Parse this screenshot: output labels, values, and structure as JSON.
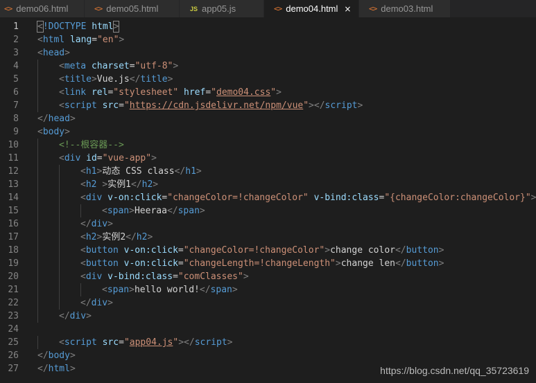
{
  "tabs": [
    {
      "label": "demo06.html",
      "icon": "html-file-icon",
      "icon_glyph": "<>",
      "active": false
    },
    {
      "label": "demo05.html",
      "icon": "html-file-icon",
      "icon_glyph": "<>",
      "active": false
    },
    {
      "label": "app05.js",
      "icon": "js-file-icon",
      "icon_glyph": "JS",
      "active": false
    },
    {
      "label": "demo04.html",
      "icon": "html-file-icon",
      "icon_glyph": "<>",
      "active": true,
      "close_glyph": "×"
    },
    {
      "label": "demo03.html",
      "icon": "html-file-icon",
      "icon_glyph": "<>",
      "active": false
    }
  ],
  "editor": {
    "current_line": 1,
    "lines": [
      {
        "n": "1",
        "indent": 0,
        "tokens": [
          [
            "punct",
            "<"
          ],
          [
            "kw",
            "!DOCTYPE"
          ],
          [
            "text",
            " "
          ],
          [
            "attr",
            "html"
          ],
          [
            "punct",
            ">"
          ]
        ]
      },
      {
        "n": "2",
        "indent": 0,
        "tokens": [
          [
            "punct",
            "<"
          ],
          [
            "tag",
            "html"
          ],
          [
            "text",
            " "
          ],
          [
            "attr",
            "lang"
          ],
          [
            "text",
            "="
          ],
          [
            "str",
            "\"en\""
          ],
          [
            "punct",
            ">"
          ]
        ]
      },
      {
        "n": "3",
        "indent": 0,
        "tokens": [
          [
            "punct",
            "<"
          ],
          [
            "tag",
            "head"
          ],
          [
            "punct",
            ">"
          ]
        ]
      },
      {
        "n": "4",
        "indent": 1,
        "tokens": [
          [
            "punct",
            "<"
          ],
          [
            "tag",
            "meta"
          ],
          [
            "text",
            " "
          ],
          [
            "attr",
            "charset"
          ],
          [
            "text",
            "="
          ],
          [
            "str",
            "\"utf-8\""
          ],
          [
            "punct",
            ">"
          ]
        ]
      },
      {
        "n": "5",
        "indent": 1,
        "tokens": [
          [
            "punct",
            "<"
          ],
          [
            "tag",
            "title"
          ],
          [
            "punct",
            ">"
          ],
          [
            "text",
            "Vue.js"
          ],
          [
            "punct",
            "</"
          ],
          [
            "tag",
            "title"
          ],
          [
            "punct",
            ">"
          ]
        ]
      },
      {
        "n": "6",
        "indent": 1,
        "tokens": [
          [
            "punct",
            "<"
          ],
          [
            "tag",
            "link"
          ],
          [
            "text",
            " "
          ],
          [
            "attr",
            "rel"
          ],
          [
            "text",
            "="
          ],
          [
            "str",
            "\"stylesheet\""
          ],
          [
            "text",
            " "
          ],
          [
            "attr",
            "href"
          ],
          [
            "text",
            "="
          ],
          [
            "str",
            "\""
          ],
          [
            "link",
            "demo04.css"
          ],
          [
            "str",
            "\""
          ],
          [
            "punct",
            ">"
          ]
        ]
      },
      {
        "n": "7",
        "indent": 1,
        "tokens": [
          [
            "punct",
            "<"
          ],
          [
            "tag",
            "script"
          ],
          [
            "text",
            " "
          ],
          [
            "attr",
            "src"
          ],
          [
            "text",
            "="
          ],
          [
            "str",
            "\""
          ],
          [
            "link",
            "https://cdn.jsdelivr.net/npm/vue"
          ],
          [
            "str",
            "\""
          ],
          [
            "punct",
            "></"
          ],
          [
            "tag",
            "script"
          ],
          [
            "punct",
            ">"
          ]
        ]
      },
      {
        "n": "8",
        "indent": 0,
        "tokens": [
          [
            "punct",
            "</"
          ],
          [
            "tag",
            "head"
          ],
          [
            "punct",
            ">"
          ]
        ]
      },
      {
        "n": "9",
        "indent": 0,
        "tokens": [
          [
            "punct",
            "<"
          ],
          [
            "tag",
            "body"
          ],
          [
            "punct",
            ">"
          ]
        ]
      },
      {
        "n": "10",
        "indent": 1,
        "tokens": [
          [
            "com",
            "<!--根容器-->"
          ]
        ]
      },
      {
        "n": "11",
        "indent": 1,
        "tokens": [
          [
            "punct",
            "<"
          ],
          [
            "tag",
            "div"
          ],
          [
            "text",
            " "
          ],
          [
            "attr",
            "id"
          ],
          [
            "text",
            "="
          ],
          [
            "str",
            "\"vue-app\""
          ],
          [
            "punct",
            ">"
          ]
        ]
      },
      {
        "n": "12",
        "indent": 2,
        "tokens": [
          [
            "punct",
            "<"
          ],
          [
            "tag",
            "h1"
          ],
          [
            "punct",
            ">"
          ],
          [
            "text",
            "动态 CSS class"
          ],
          [
            "punct",
            "</"
          ],
          [
            "tag",
            "h1"
          ],
          [
            "punct",
            ">"
          ]
        ]
      },
      {
        "n": "13",
        "indent": 2,
        "tokens": [
          [
            "punct",
            "<"
          ],
          [
            "tag",
            "h2"
          ],
          [
            "text",
            " "
          ],
          [
            "punct",
            ">"
          ],
          [
            "text",
            "实例1"
          ],
          [
            "punct",
            "</"
          ],
          [
            "tag",
            "h2"
          ],
          [
            "punct",
            ">"
          ]
        ]
      },
      {
        "n": "14",
        "indent": 2,
        "tokens": [
          [
            "punct",
            "<"
          ],
          [
            "tag",
            "div"
          ],
          [
            "text",
            " "
          ],
          [
            "attr",
            "v-on:click"
          ],
          [
            "text",
            "="
          ],
          [
            "str",
            "\"changeColor=!changeColor\""
          ],
          [
            "text",
            " "
          ],
          [
            "attr",
            "v-bind:class"
          ],
          [
            "text",
            "="
          ],
          [
            "str",
            "\"{changeColor:changeColor}\""
          ],
          [
            "punct",
            ">"
          ]
        ]
      },
      {
        "n": "15",
        "indent": 3,
        "tokens": [
          [
            "punct",
            "<"
          ],
          [
            "tag",
            "span"
          ],
          [
            "punct",
            ">"
          ],
          [
            "text",
            "Heeraa"
          ],
          [
            "punct",
            "</"
          ],
          [
            "tag",
            "span"
          ],
          [
            "punct",
            ">"
          ]
        ]
      },
      {
        "n": "16",
        "indent": 2,
        "tokens": [
          [
            "punct",
            "</"
          ],
          [
            "tag",
            "div"
          ],
          [
            "punct",
            ">"
          ]
        ]
      },
      {
        "n": "17",
        "indent": 2,
        "tokens": [
          [
            "punct",
            "<"
          ],
          [
            "tag",
            "h2"
          ],
          [
            "punct",
            ">"
          ],
          [
            "text",
            "实例2"
          ],
          [
            "punct",
            "</"
          ],
          [
            "tag",
            "h2"
          ],
          [
            "punct",
            ">"
          ]
        ]
      },
      {
        "n": "18",
        "indent": 2,
        "tokens": [
          [
            "punct",
            "<"
          ],
          [
            "tag",
            "button"
          ],
          [
            "text",
            " "
          ],
          [
            "attr",
            "v-on:click"
          ],
          [
            "text",
            "="
          ],
          [
            "str",
            "\"changeColor=!changeColor\""
          ],
          [
            "punct",
            ">"
          ],
          [
            "text",
            "change color"
          ],
          [
            "punct",
            "</"
          ],
          [
            "tag",
            "button"
          ],
          [
            "punct",
            ">"
          ]
        ]
      },
      {
        "n": "19",
        "indent": 2,
        "tokens": [
          [
            "punct",
            "<"
          ],
          [
            "tag",
            "button"
          ],
          [
            "text",
            " "
          ],
          [
            "attr",
            "v-on:click"
          ],
          [
            "text",
            "="
          ],
          [
            "str",
            "\"changeLength=!changeLength\""
          ],
          [
            "punct",
            ">"
          ],
          [
            "text",
            "change len"
          ],
          [
            "punct",
            "</"
          ],
          [
            "tag",
            "button"
          ],
          [
            "punct",
            ">"
          ]
        ]
      },
      {
        "n": "20",
        "indent": 2,
        "tokens": [
          [
            "punct",
            "<"
          ],
          [
            "tag",
            "div"
          ],
          [
            "text",
            " "
          ],
          [
            "attr",
            "v-bind:class"
          ],
          [
            "text",
            "="
          ],
          [
            "str",
            "\"comClasses\""
          ],
          [
            "punct",
            ">"
          ]
        ]
      },
      {
        "n": "21",
        "indent": 3,
        "tokens": [
          [
            "punct",
            "<"
          ],
          [
            "tag",
            "span"
          ],
          [
            "punct",
            ">"
          ],
          [
            "text",
            "hello world!"
          ],
          [
            "punct",
            "</"
          ],
          [
            "tag",
            "span"
          ],
          [
            "punct",
            ">"
          ]
        ]
      },
      {
        "n": "22",
        "indent": 2,
        "tokens": [
          [
            "punct",
            "</"
          ],
          [
            "tag",
            "div"
          ],
          [
            "punct",
            ">"
          ]
        ]
      },
      {
        "n": "23",
        "indent": 1,
        "tokens": [
          [
            "punct",
            "</"
          ],
          [
            "tag",
            "div"
          ],
          [
            "punct",
            ">"
          ]
        ]
      },
      {
        "n": "24",
        "indent": 0,
        "tokens": []
      },
      {
        "n": "25",
        "indent": 1,
        "tokens": [
          [
            "punct",
            "<"
          ],
          [
            "tag",
            "script"
          ],
          [
            "text",
            " "
          ],
          [
            "attr",
            "src"
          ],
          [
            "text",
            "="
          ],
          [
            "str",
            "\""
          ],
          [
            "link",
            "app04.js"
          ],
          [
            "str",
            "\""
          ],
          [
            "punct",
            "></"
          ],
          [
            "tag",
            "script"
          ],
          [
            "punct",
            ">"
          ]
        ]
      },
      {
        "n": "26",
        "indent": 0,
        "tokens": [
          [
            "punct",
            "</"
          ],
          [
            "tag",
            "body"
          ],
          [
            "punct",
            ">"
          ]
        ]
      },
      {
        "n": "27",
        "indent": 0,
        "tokens": [
          [
            "punct",
            "</"
          ],
          [
            "tag",
            "html"
          ],
          [
            "punct",
            ">"
          ]
        ]
      }
    ]
  },
  "watermark": "https://blog.csdn.net/qq_35723619",
  "colors": {
    "background": "#1e1e1e",
    "tab_bar": "#252526",
    "tab_inactive": "#2d2d2d",
    "tag": "#569cd6",
    "attribute": "#9cdcfe",
    "string": "#ce9178",
    "comment": "#6a9955",
    "text": "#d4d4d4",
    "line_number": "#858585"
  }
}
